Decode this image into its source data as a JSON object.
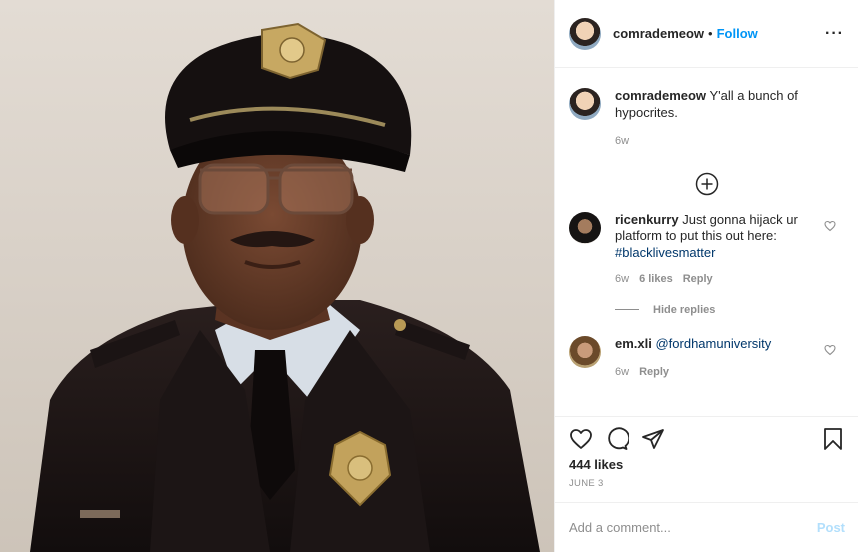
{
  "post": {
    "username": "comrademeow",
    "separator": "•",
    "follow_label": "Follow",
    "more_label": "···",
    "photo_icon": "officer-portrait"
  },
  "caption": {
    "username": "comrademeow",
    "text": "Y'all a bunch of hypocrites.",
    "time": "6w"
  },
  "comments": [
    {
      "username": "ricenkurry",
      "text": "Just gonna hijack ur platform to put this out here:",
      "hashtag": "#blacklivesmatter",
      "time": "6w",
      "likes": "6 likes",
      "reply": "Reply",
      "hide_replies": "Hide replies"
    },
    {
      "username": "em.xli",
      "mention": "@fordhamuniversity",
      "time": "6w",
      "reply": "Reply"
    }
  ],
  "footer": {
    "likes": "444 likes",
    "date": "JUNE 3",
    "comment_placeholder": "Add a comment...",
    "post_label": "Post"
  },
  "colors": {
    "accent": "#0095f6",
    "post_disabled": "#b2dffc",
    "hashtag": "#00376b"
  }
}
